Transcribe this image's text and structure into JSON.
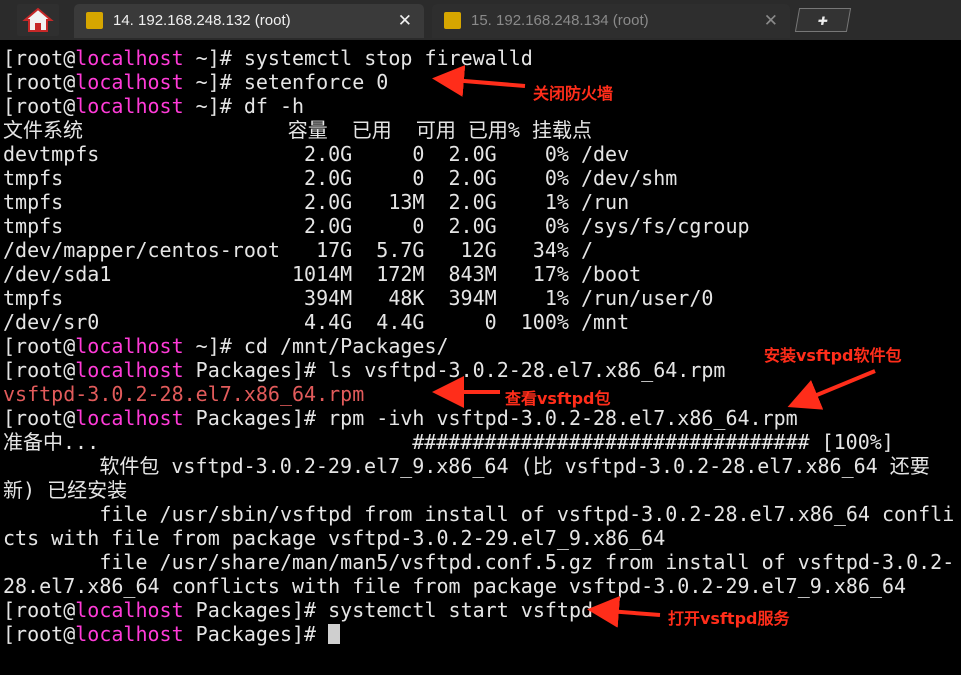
{
  "tabs": [
    {
      "label": "14. 192.168.248.132 (root)",
      "active": true
    },
    {
      "label": "15. 192.168.248.134 (root)",
      "active": false
    }
  ],
  "terminal": {
    "lines": [
      [
        {
          "t": "[root@"
        },
        {
          "t": "localhost",
          "c": "host"
        },
        {
          "t": " ~]# systemctl stop firewalld"
        }
      ],
      [
        {
          "t": "[root@"
        },
        {
          "t": "localhost",
          "c": "host"
        },
        {
          "t": " ~]# setenforce 0"
        }
      ],
      [
        {
          "t": "[root@"
        },
        {
          "t": "localhost",
          "c": "host"
        },
        {
          "t": " ~]# df -h"
        }
      ],
      [
        {
          "t": "文件系统                 容量  已用  可用 已用% 挂载点"
        }
      ],
      [
        {
          "t": "devtmpfs                 2.0G     0  2.0G    0% /dev"
        }
      ],
      [
        {
          "t": "tmpfs                    2.0G     0  2.0G    0% /dev/shm"
        }
      ],
      [
        {
          "t": "tmpfs                    2.0G   13M  2.0G    1% /run"
        }
      ],
      [
        {
          "t": "tmpfs                    2.0G     0  2.0G    0% /sys/fs/cgroup"
        }
      ],
      [
        {
          "t": "/dev/mapper/centos-root   17G  5.7G   12G   34% /"
        }
      ],
      [
        {
          "t": "/dev/sda1               1014M  172M  843M   17% /boot"
        }
      ],
      [
        {
          "t": "tmpfs                    394M   48K  394M    1% /run/user/0"
        }
      ],
      [
        {
          "t": "/dev/sr0                 4.4G  4.4G     0  100% /mnt"
        }
      ],
      [
        {
          "t": "[root@"
        },
        {
          "t": "localhost",
          "c": "host"
        },
        {
          "t": " ~]# cd /mnt/Packages/"
        }
      ],
      [
        {
          "t": "[root@"
        },
        {
          "t": "localhost",
          "c": "host"
        },
        {
          "t": " Packages]# ls vsftpd-3.0.2-28.el7.x86_64.rpm"
        }
      ],
      [
        {
          "t": "vsftpd-3.0.2-28.el7.x86_64.rpm",
          "c": "red"
        }
      ],
      [
        {
          "t": "[root@"
        },
        {
          "t": "localhost",
          "c": "host"
        },
        {
          "t": " Packages]# rpm -ivh vsftpd-3.0.2-28.el7.x86_64.rpm"
        }
      ],
      [
        {
          "t": "准备中...                          ################################# [100%]"
        }
      ],
      [
        {
          "t": "        软件包 vsftpd-3.0.2-29.el7_9.x86_64 (比 vsftpd-3.0.2-28.el7.x86_64 还要"
        }
      ],
      [
        {
          "t": "新) 已经安装"
        }
      ],
      [
        {
          "t": "        file /usr/sbin/vsftpd from install of vsftpd-3.0.2-28.el7.x86_64 confli"
        }
      ],
      [
        {
          "t": "cts with file from package vsftpd-3.0.2-29.el7_9.x86_64"
        }
      ],
      [
        {
          "t": "        file /usr/share/man/man5/vsftpd.conf.5.gz from install of vsftpd-3.0.2-"
        }
      ],
      [
        {
          "t": "28.el7.x86_64 conflicts with file from package vsftpd-3.0.2-29.el7_9.x86_64"
        }
      ],
      [
        {
          "t": "[root@"
        },
        {
          "t": "localhost",
          "c": "host"
        },
        {
          "t": " Packages]# systemctl start vsftpd"
        }
      ],
      [
        {
          "t": "[root@"
        },
        {
          "t": "localhost",
          "c": "host"
        },
        {
          "t": " Packages]# "
        },
        {
          "t": "",
          "c": "cursor"
        }
      ]
    ]
  },
  "annotations": {
    "firewall": "关闭防火墙",
    "install": "安装vsftpd软件包",
    "view": "查看vsftpd包",
    "start": "打开vsftpd服务"
  },
  "colors": {
    "accent": "#ff2d1a",
    "host": "#ff3bd8",
    "rpm_file": "#e25b5b"
  },
  "icons": {
    "home": "home-icon",
    "tab": "wrench-icon",
    "new_tab": "plus-icon"
  }
}
